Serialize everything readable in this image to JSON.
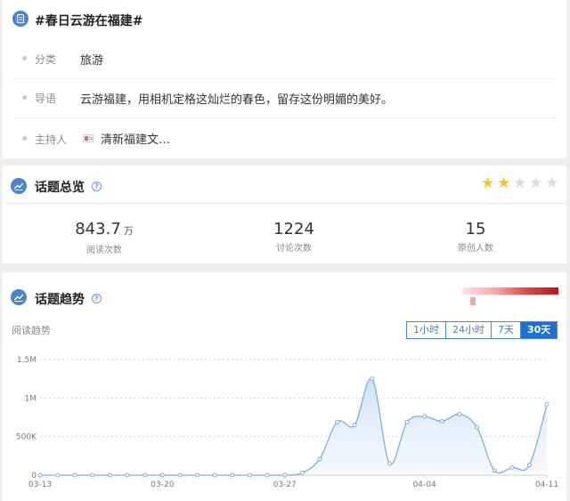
{
  "topic": {
    "title": "#春日云游在福建#",
    "rows": [
      {
        "label": "分类",
        "value": "旅游"
      },
      {
        "label": "导语",
        "value": "云游福建，用相机定格这灿烂的春色，留存这份明媚的美好。"
      },
      {
        "label": "主持人",
        "value": "清新福建文…"
      }
    ]
  },
  "overview": {
    "title": "话题总览",
    "rating": {
      "filled": 2,
      "total": 5
    },
    "stats": [
      {
        "value": "843.7",
        "unit": "万",
        "label": "阅读次数"
      },
      {
        "value": "1224",
        "unit": "",
        "label": "讨论次数"
      },
      {
        "value": "15",
        "unit": "",
        "label": "原创人数"
      }
    ]
  },
  "trend": {
    "title": "话题趋势",
    "series_label": "阅读趋势",
    "ranges": [
      "1小时",
      "24小时",
      "7天",
      "30天"
    ],
    "active_range": "30天"
  },
  "colors": {
    "accent": "#1e6fd0",
    "line": "#7eaee6",
    "star_filled": "#f5c12c",
    "star_empty": "#dcdcdc"
  },
  "chart_data": {
    "type": "area",
    "x_tick_labels": [
      "03-13",
      "03-20",
      "03-27",
      "04-04",
      "04-11"
    ],
    "y_tick_labels": [
      "0",
      "500K",
      "1M",
      "1.5M"
    ],
    "ylim": [
      0,
      1500000
    ],
    "grid": true,
    "x": [
      "03-13",
      "03-14",
      "03-15",
      "03-16",
      "03-17",
      "03-18",
      "03-19",
      "03-20",
      "03-21",
      "03-22",
      "03-23",
      "03-24",
      "03-25",
      "03-26",
      "03-27",
      "03-28",
      "03-29",
      "03-30",
      "03-31",
      "04-01",
      "04-02",
      "04-03",
      "04-04",
      "04-05",
      "04-06",
      "04-07",
      "04-08",
      "04-09",
      "04-10",
      "04-11"
    ],
    "values": [
      0,
      0,
      0,
      0,
      0,
      0,
      0,
      0,
      0,
      0,
      0,
      0,
      0,
      0,
      0,
      30000,
      210000,
      690000,
      650000,
      1250000,
      150000,
      690000,
      760000,
      700000,
      790000,
      620000,
      60000,
      100000,
      130000,
      920000
    ]
  }
}
